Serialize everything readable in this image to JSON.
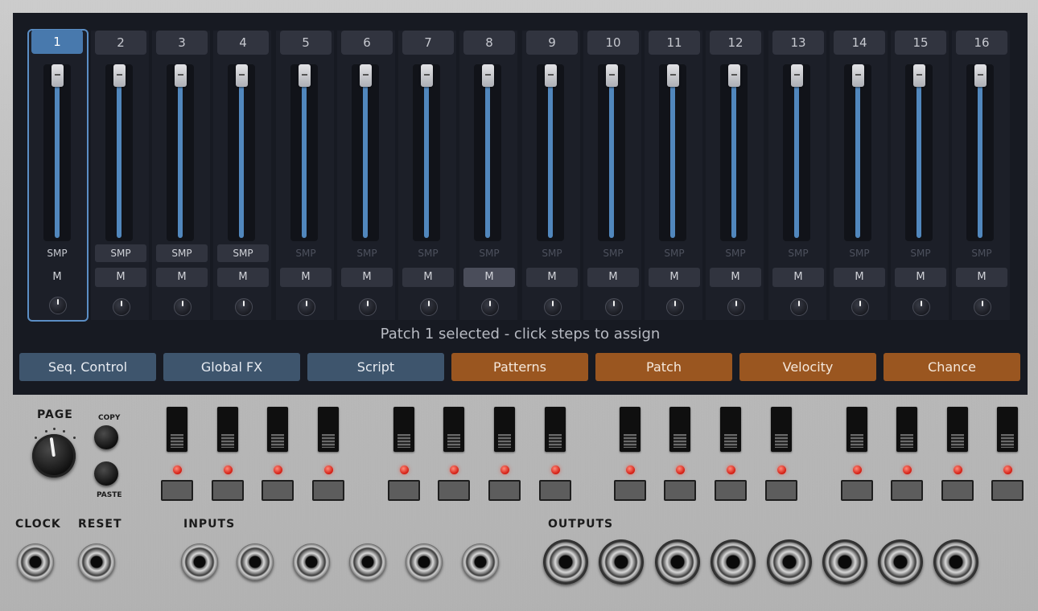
{
  "channels": [
    {
      "num": "1",
      "smp": "SMP",
      "mute": "M"
    },
    {
      "num": "2",
      "smp": "SMP",
      "mute": "M"
    },
    {
      "num": "3",
      "smp": "SMP",
      "mute": "M"
    },
    {
      "num": "4",
      "smp": "SMP",
      "mute": "M"
    },
    {
      "num": "5",
      "smp": "SMP",
      "mute": "M"
    },
    {
      "num": "6",
      "smp": "SMP",
      "mute": "M"
    },
    {
      "num": "7",
      "smp": "SMP",
      "mute": "M"
    },
    {
      "num": "8",
      "smp": "SMP",
      "mute": "M"
    },
    {
      "num": "9",
      "smp": "SMP",
      "mute": "M"
    },
    {
      "num": "10",
      "smp": "SMP",
      "mute": "M"
    },
    {
      "num": "11",
      "smp": "SMP",
      "mute": "M"
    },
    {
      "num": "12",
      "smp": "SMP",
      "mute": "M"
    },
    {
      "num": "13",
      "smp": "SMP",
      "mute": "M"
    },
    {
      "num": "14",
      "smp": "SMP",
      "mute": "M"
    },
    {
      "num": "15",
      "smp": "SMP",
      "mute": "M"
    },
    {
      "num": "16",
      "smp": "SMP",
      "mute": "M"
    }
  ],
  "selected_channel": "1",
  "status_text": "Patch 1 selected - click steps to assign",
  "tabs": [
    {
      "label": "Seq. Control",
      "color": "#3e556d"
    },
    {
      "label": "Global FX",
      "color": "#3e556d"
    },
    {
      "label": "Script",
      "color": "#3e556d"
    },
    {
      "label": "Patterns",
      "color": "#9a5620"
    },
    {
      "label": "Patch",
      "color": "#9a5620"
    },
    {
      "label": "Velocity",
      "color": "#9a5620"
    },
    {
      "label": "Chance",
      "color": "#9a5620"
    }
  ],
  "panel": {
    "page_label": "PAGE",
    "copy_label": "COPY",
    "paste_label": "PASTE",
    "clock_label": "CLOCK",
    "reset_label": "RESET",
    "inputs_label": "INPUTS",
    "outputs_label": "OUTPUTS"
  },
  "colors": {
    "accent": "#5187bd",
    "selected": "#4879ad",
    "led": "#d21b10",
    "tab_blue": "#3e556d",
    "tab_orange": "#9a5620"
  }
}
